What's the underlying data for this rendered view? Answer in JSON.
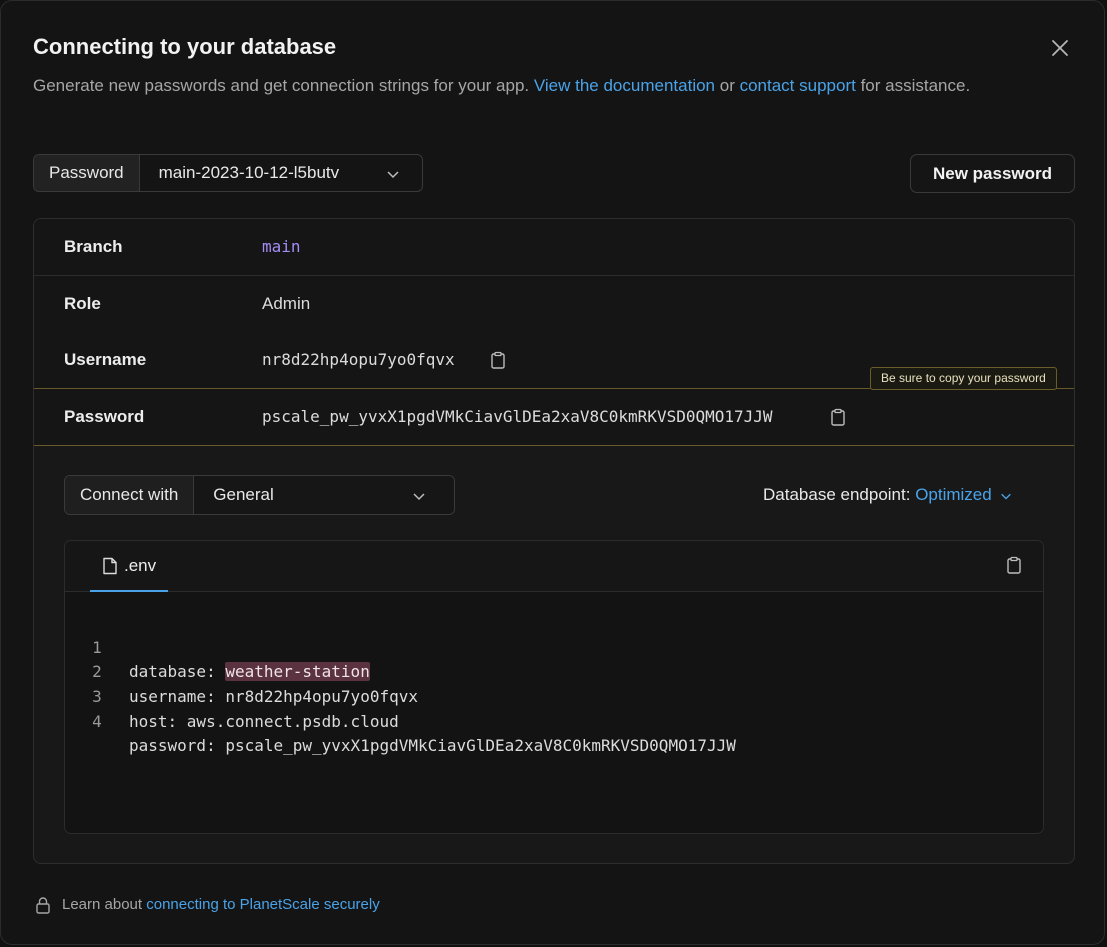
{
  "modal": {
    "title": "Connecting to your database",
    "description_prefix": "Generate new passwords and get connection strings for your app.",
    "link_docs": "View the documentation",
    "or_text": "or",
    "link_support": "contact support",
    "description_suffix": "for assistance."
  },
  "password_select": {
    "label": "Password",
    "value": "main-2023-10-12-l5butv"
  },
  "new_password_button": "New password",
  "details": {
    "branch": {
      "key": "Branch",
      "value": "main"
    },
    "role": {
      "key": "Role",
      "value": "Admin"
    },
    "username": {
      "key": "Username",
      "value": "nr8d22hp4opu7yo0fqvx"
    },
    "password": {
      "key": "Password",
      "value": "pscale_pw_yvxX1pgdVMkCiavGlDEa2xaV8C0kmRKVSD0QMO17JJW"
    },
    "tooltip": "Be sure to copy your password"
  },
  "connect_with": {
    "label": "Connect with",
    "value": "General"
  },
  "endpoint": {
    "label": "Database endpoint:",
    "value": "Optimized"
  },
  "code": {
    "tab": ".env",
    "lines": [
      {
        "n": "1",
        "key": "database: ",
        "value": "weather-station"
      },
      {
        "n": "2",
        "text": "username: nr8d22hp4opu7yo0fqvx"
      },
      {
        "n": "3",
        "text": "host: aws.connect.psdb.cloud"
      },
      {
        "n": "4",
        "text": "password: pscale_pw_yvxX1pgdVMkCiavGlDEa2xaV8C0kmRKVSD0QMO17JJW"
      }
    ]
  },
  "footer": {
    "text": "Learn about",
    "link": "connecting to PlanetScale securely"
  },
  "colors": {
    "accent": "#4aa3e8",
    "branch": "#a48cf5",
    "highlight": "#5a3240",
    "tooltip_border": "#6b5d2a"
  }
}
